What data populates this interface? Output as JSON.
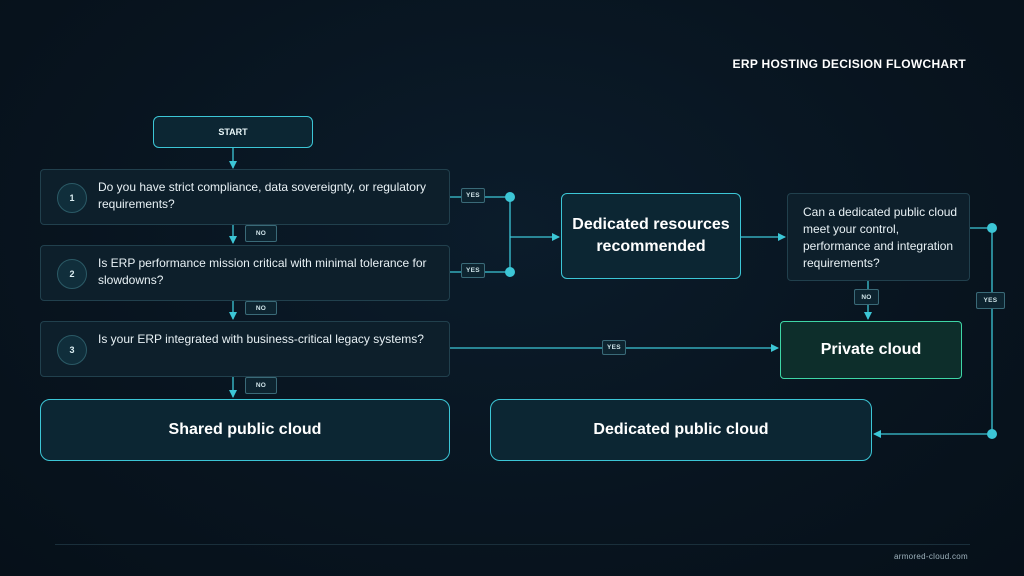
{
  "title": "ERP HOSTING DECISION FLOWCHART",
  "start": "START",
  "questions": [
    {
      "number": "1",
      "text": "Do you have strict compliance, data sovereignty, or regulatory requirements?"
    },
    {
      "number": "2",
      "text": "Is ERP performance mission critical with minimal tolerance for slowdowns?"
    },
    {
      "number": "3",
      "text": "Is your ERP integrated with business-critical legacy systems?"
    }
  ],
  "labels": {
    "yes": "YES",
    "no": "NO"
  },
  "dedicated_resources": "Dedicated resources recommended",
  "question_dedicated": "Can a dedicated public cloud meet your control, performance and integration requirements?",
  "private_cloud": "Private cloud",
  "shared_public_cloud": "Shared public cloud",
  "dedicated_public_cloud": "Dedicated public cloud",
  "footer": "armored-cloud.com",
  "colors": {
    "accent": "#3cc6d6",
    "private_border": "#3ed6a6",
    "background": "#08141f"
  }
}
